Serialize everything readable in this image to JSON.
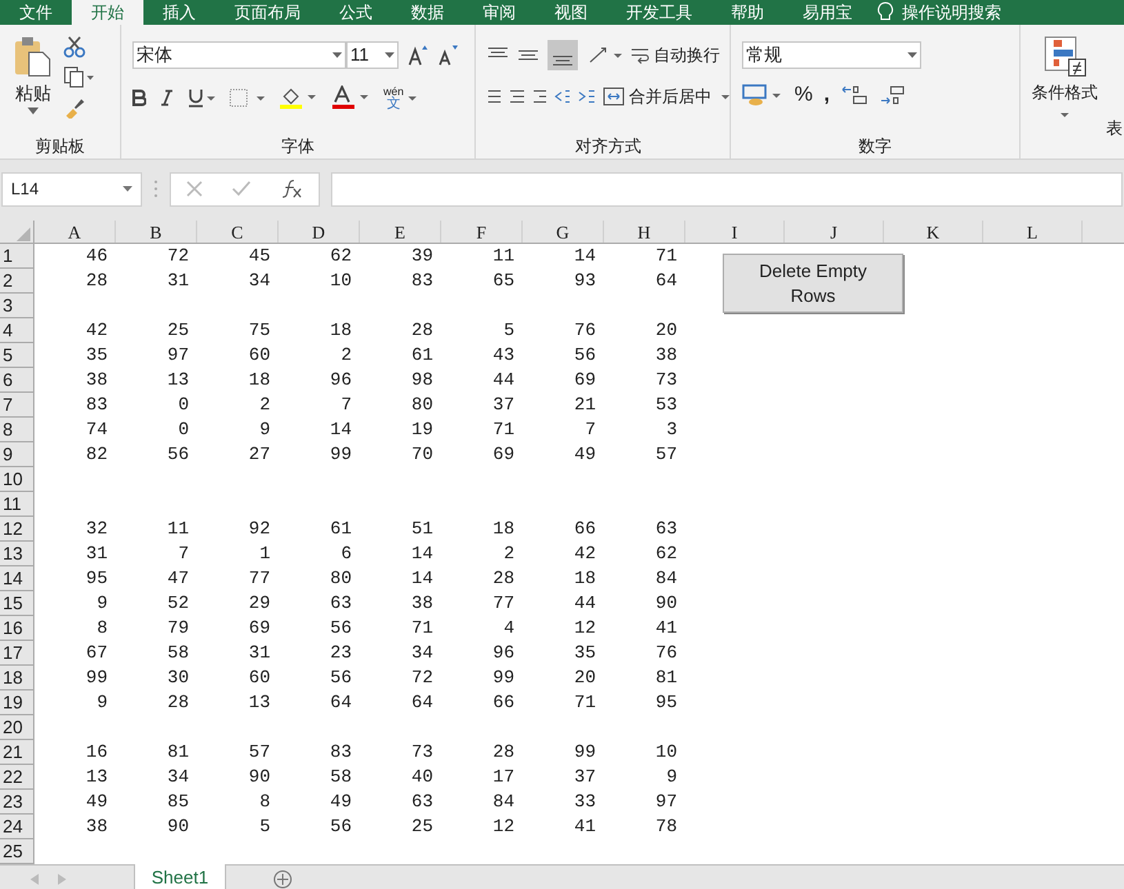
{
  "ribbon_tabs": [
    {
      "label": "文件",
      "selected": false
    },
    {
      "label": "开始",
      "selected": true
    },
    {
      "label": "插入",
      "selected": false
    },
    {
      "label": "页面布局",
      "selected": false
    },
    {
      "label": "公式",
      "selected": false
    },
    {
      "label": "数据",
      "selected": false
    },
    {
      "label": "审阅",
      "selected": false
    },
    {
      "label": "视图",
      "selected": false
    },
    {
      "label": "开发工具",
      "selected": false
    },
    {
      "label": "帮助",
      "selected": false
    },
    {
      "label": "易用宝",
      "selected": false
    },
    {
      "label": "操作说明搜索",
      "selected": false
    }
  ],
  "ribbon": {
    "clipboard": {
      "paste_label": "粘贴",
      "group_label": "剪贴板"
    },
    "font": {
      "font_name": "宋体",
      "font_size": "11",
      "phonetic_top": "wén",
      "phonetic_bottom": "文",
      "group_label": "字体"
    },
    "alignment": {
      "wrap_text": "自动换行",
      "merge_center": "合并后居中",
      "group_label": "对齐方式"
    },
    "number": {
      "format": "常规",
      "percent": "%",
      "comma": ",",
      "group_label": "数字"
    },
    "styles": {
      "conditional_format": "条件格式",
      "next_label": "表"
    }
  },
  "name_box": "L14",
  "columns": [
    "A",
    "B",
    "C",
    "D",
    "E",
    "F",
    "G",
    "H",
    "I",
    "J",
    "K",
    "L"
  ],
  "rows": [
    {
      "header": "1",
      "cells": [
        "46",
        "72",
        "45",
        "62",
        "39",
        "11",
        "14",
        "71"
      ]
    },
    {
      "header": "2",
      "cells": [
        "28",
        "31",
        "34",
        "10",
        "83",
        "65",
        "93",
        "64"
      ]
    },
    {
      "header": "3",
      "cells": []
    },
    {
      "header": "4",
      "cells": [
        "42",
        "25",
        "75",
        "18",
        "28",
        "5",
        "76",
        "20"
      ]
    },
    {
      "header": "5",
      "cells": [
        "35",
        "97",
        "60",
        "2",
        "61",
        "43",
        "56",
        "38"
      ]
    },
    {
      "header": "6",
      "cells": [
        "38",
        "13",
        "18",
        "96",
        "98",
        "44",
        "69",
        "73"
      ]
    },
    {
      "header": "7",
      "cells": [
        "83",
        "0",
        "2",
        "7",
        "80",
        "37",
        "21",
        "53"
      ]
    },
    {
      "header": "8",
      "cells": [
        "74",
        "0",
        "9",
        "14",
        "19",
        "71",
        "7",
        "3"
      ]
    },
    {
      "header": "9",
      "cells": [
        "82",
        "56",
        "27",
        "99",
        "70",
        "69",
        "49",
        "57"
      ]
    },
    {
      "header": "10",
      "cells": []
    },
    {
      "header": "11",
      "cells": []
    },
    {
      "header": "12",
      "cells": [
        "32",
        "11",
        "92",
        "61",
        "51",
        "18",
        "66",
        "63"
      ]
    },
    {
      "header": "13",
      "cells": [
        "31",
        "7",
        "1",
        "6",
        "14",
        "2",
        "42",
        "62"
      ]
    },
    {
      "header": "14",
      "cells": [
        "95",
        "47",
        "77",
        "80",
        "14",
        "28",
        "18",
        "84"
      ]
    },
    {
      "header": "15",
      "cells": [
        "9",
        "52",
        "29",
        "63",
        "38",
        "77",
        "44",
        "90"
      ]
    },
    {
      "header": "16",
      "cells": [
        "8",
        "79",
        "69",
        "56",
        "71",
        "4",
        "12",
        "41"
      ]
    },
    {
      "header": "17",
      "cells": [
        "67",
        "58",
        "31",
        "23",
        "34",
        "96",
        "35",
        "76"
      ]
    },
    {
      "header": "18",
      "cells": [
        "99",
        "30",
        "60",
        "56",
        "72",
        "99",
        "20",
        "81"
      ]
    },
    {
      "header": "19",
      "cells": [
        "9",
        "28",
        "13",
        "64",
        "64",
        "66",
        "71",
        "95"
      ]
    },
    {
      "header": "20",
      "cells": []
    },
    {
      "header": "21",
      "cells": [
        "16",
        "81",
        "57",
        "83",
        "73",
        "28",
        "99",
        "10"
      ]
    },
    {
      "header": "22",
      "cells": [
        "13",
        "34",
        "90",
        "58",
        "40",
        "17",
        "37",
        "9"
      ]
    },
    {
      "header": "23",
      "cells": [
        "49",
        "85",
        "8",
        "49",
        "63",
        "84",
        "33",
        "97"
      ]
    },
    {
      "header": "24",
      "cells": [
        "38",
        "90",
        "5",
        "56",
        "25",
        "12",
        "41",
        "78"
      ]
    },
    {
      "header": "25",
      "cells": []
    }
  ],
  "macro_button": "Delete Empty Rows",
  "sheet_tabs": [
    {
      "label": "Sheet1",
      "selected": true
    }
  ]
}
